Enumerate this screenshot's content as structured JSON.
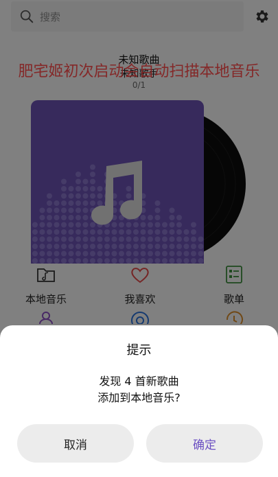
{
  "search": {
    "placeholder": "搜索"
  },
  "now_playing": {
    "title": "未知歌曲",
    "artist": "未知歌手",
    "progress": "0/1"
  },
  "overlay_tip": "肥宅姬初次启动会自动扫描本地音乐",
  "quick_nav": {
    "items": [
      {
        "label": "本地音乐",
        "icon": "folder-music-icon"
      },
      {
        "label": "我喜欢",
        "icon": "heart-icon"
      },
      {
        "label": "歌单",
        "icon": "playlist-icon"
      }
    ]
  },
  "dialog": {
    "title": "提示",
    "message_line1": "发现 4 首新歌曲",
    "message_line2": "添加到本地音乐?",
    "cancel_label": "取消",
    "confirm_label": "确定"
  },
  "colors": {
    "accent": "#6b4fc2",
    "album": "#6a52b0",
    "tip_red": "#ff3b3b",
    "heart": "#e04a4a",
    "playlist": "#3a8a3a"
  }
}
